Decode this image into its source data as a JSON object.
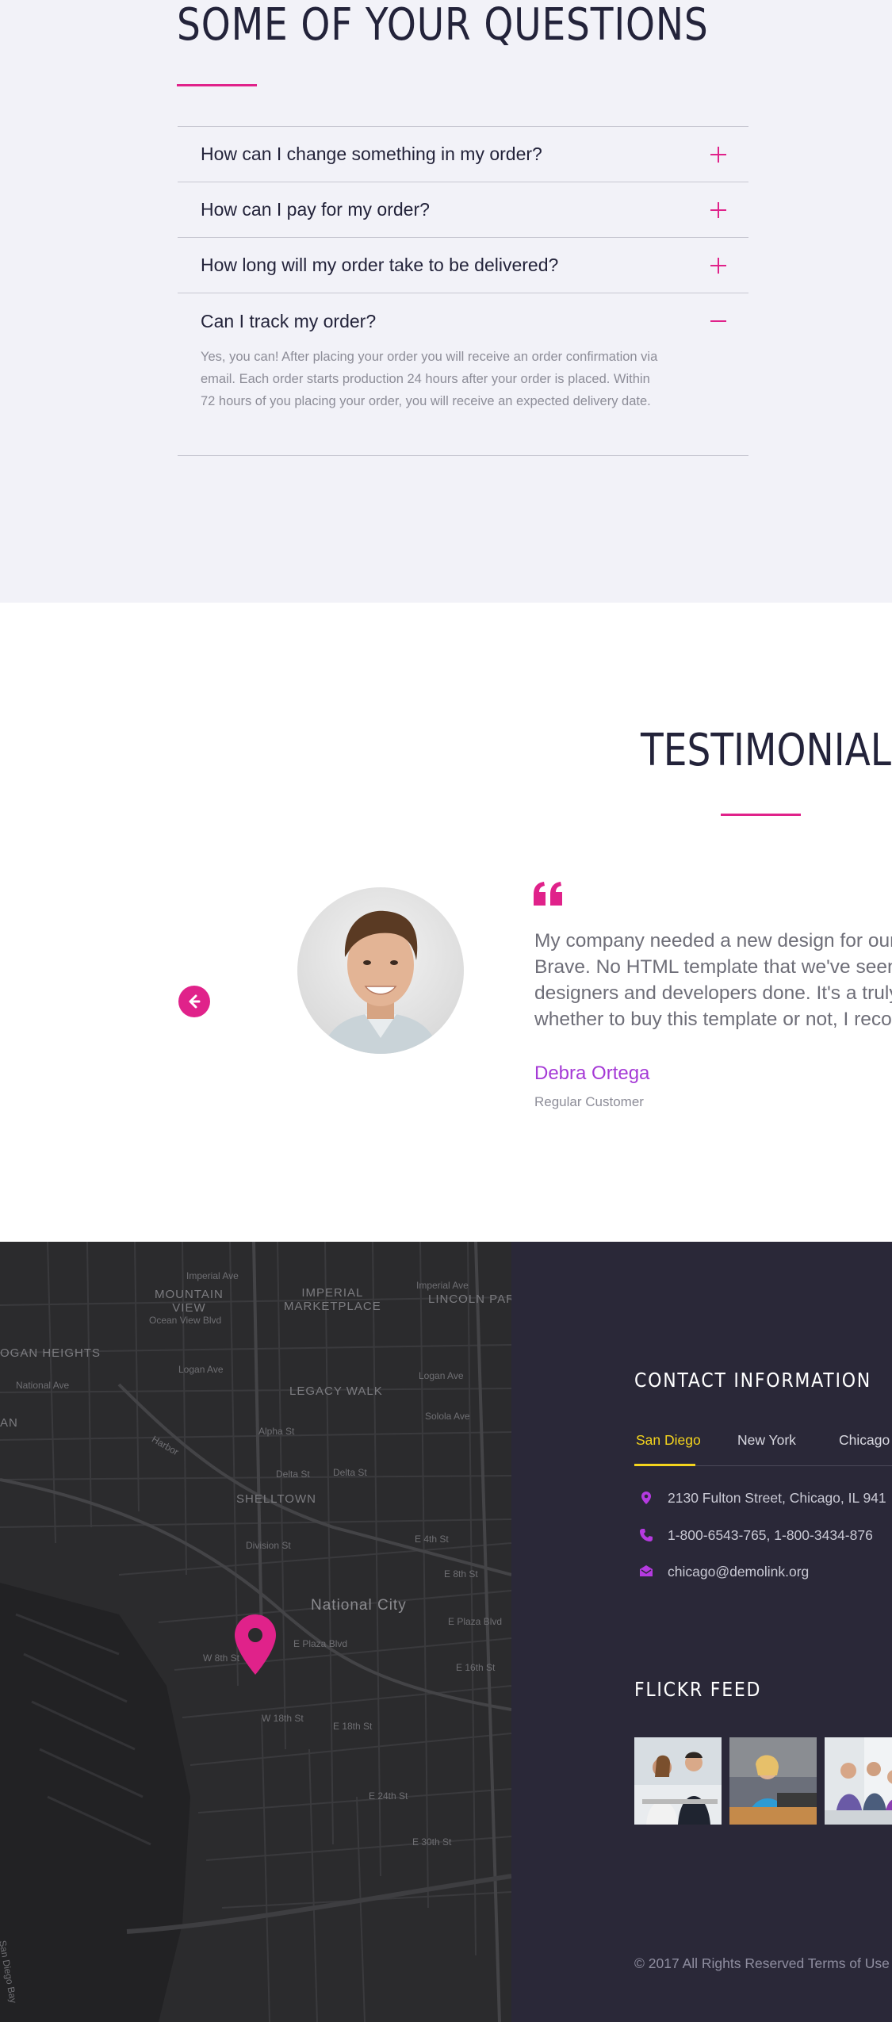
{
  "faq": {
    "title": "SOME OF YOUR QUESTIONS",
    "items": [
      {
        "question": "How can I change something in my order?",
        "icon": "plus-icon",
        "expanded": false
      },
      {
        "question": "How can I pay for my order?",
        "icon": "plus-icon",
        "expanded": false
      },
      {
        "question": "How long will my order take to be delivered?",
        "icon": "plus-icon",
        "expanded": false
      },
      {
        "question": "Can I track my order?",
        "icon": "minus-icon",
        "expanded": true,
        "answer": "Yes, you can! After placing your order you will receive an order confirmation via email. Each order starts production 24 hours after your order is placed. Within 72 hours of you placing your order, you will receive an expected delivery date."
      }
    ]
  },
  "testimonials": {
    "title": "TESTIMONIALS",
    "quote_lines": [
      "My company needed a new design for our ne",
      "Brave. No HTML template that we've seen be",
      "designers and developers done. It's a truly am",
      "whether to buy this template or not, I recomm"
    ],
    "author": "Debra Ortega",
    "role": "Regular Customer",
    "prev_icon": "arrow-left-icon",
    "quote_icon": "quote-icon"
  },
  "map": {
    "labels": {
      "mountain_view": "MOUNTAIN\nVIEW",
      "imperial_marketplace": "IMPERIAL\nMARKETPLACE",
      "lincoln_park": "LINCOLN PAR",
      "logan_heights": "OGAN HEIGHTS",
      "legacy_walk": "LEGACY WALK",
      "shelltown": "SHELLTOWN",
      "national_city": "National City",
      "an": "AN",
      "imperial_ave_1": "Imperial Ave",
      "imperial_ave_2": "Imperial Ave",
      "ocean_view": "Ocean View Blvd",
      "national_ave": "National Ave",
      "logan_ave_1": "Logan Ave",
      "logan_ave_2": "Logan Ave",
      "solola_ave": "Solola Ave",
      "alpha_st": "Alpha St",
      "delta_st_1": "Delta St",
      "delta_st_2": "Delta St",
      "division_st": "Division St",
      "e_4th_st": "E 4th St",
      "e_8th_st_1": "E 8th St",
      "e_plaza_blvd_1": "E Plaza Blvd",
      "e_plaza_blvd_2": "E Plaza Blvd",
      "w_8th_st": "W 8th St",
      "e_16th_st": "E 16th St",
      "w_18th_st": "W 18th St",
      "e_18th_st": "E 18th St",
      "e_24th_st": "E 24th St",
      "e_30th_st": "E 30th St",
      "san_diego_bay": "San Diego Bay",
      "harbor": "Harbor"
    },
    "pin_icon": "map-pin-icon"
  },
  "contact": {
    "title": "CONTACT INFORMATION",
    "tabs": [
      {
        "label": "San Diego",
        "active": true
      },
      {
        "label": "New York",
        "active": false
      },
      {
        "label": "Chicago",
        "active": false
      }
    ],
    "address": "2130 Fulton Street, Chicago, IL 941",
    "phone": "1-800-6543-765, 1-800-3434-876",
    "email": "chicago@demolink.org",
    "flickr_title": "FLICKR FEED",
    "copyright": "© 2017 All Rights Reserved Terms of Use"
  },
  "colors": {
    "accent": "#e0228a",
    "author": "#a53ad6",
    "tab_active": "#f4d41d",
    "footer_bg": "#2a2838",
    "faq_bg": "#f2f2f8",
    "heading": "#23233a"
  }
}
